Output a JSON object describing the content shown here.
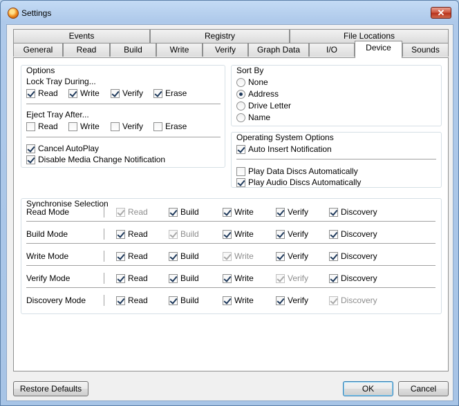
{
  "window": {
    "title": "Settings",
    "close_glyph": "✕"
  },
  "tabs": {
    "row_back": [
      "Events",
      "Registry",
      "File Locations"
    ],
    "row_front": [
      "General",
      "Read",
      "Build",
      "Write",
      "Verify",
      "Graph Data",
      "I/O",
      "Device",
      "Sounds"
    ],
    "active": "Device"
  },
  "options": {
    "title": "Options",
    "lock_label": "Lock Tray During...",
    "lock": [
      {
        "label": "Read",
        "checked": true
      },
      {
        "label": "Write",
        "checked": true
      },
      {
        "label": "Verify",
        "checked": true
      },
      {
        "label": "Erase",
        "checked": true
      }
    ],
    "eject_label": "Eject Tray After...",
    "eject": [
      {
        "label": "Read",
        "checked": false
      },
      {
        "label": "Write",
        "checked": false
      },
      {
        "label": "Verify",
        "checked": false
      },
      {
        "label": "Erase",
        "checked": false
      }
    ],
    "cancel_autoplay": {
      "label": "Cancel AutoPlay",
      "checked": true
    },
    "disable_media": {
      "label": "Disable Media Change Notification",
      "checked": true
    }
  },
  "sort_by": {
    "title": "Sort By",
    "options": [
      "None",
      "Address",
      "Drive Letter",
      "Name"
    ],
    "selected": "Address"
  },
  "os_options": {
    "title": "Operating System Options",
    "auto_insert": {
      "label": "Auto Insert Notification",
      "checked": true
    },
    "play_data": {
      "label": "Play Data Discs Automatically",
      "checked": false
    },
    "play_audio": {
      "label": "Play Audio Discs Automatically",
      "checked": true
    }
  },
  "sync": {
    "title": "Synchronise Selection",
    "columns": [
      "Read",
      "Build",
      "Write",
      "Verify",
      "Discovery"
    ],
    "rows": [
      {
        "label": "Read Mode",
        "disabled_col": 0
      },
      {
        "label": "Build Mode",
        "disabled_col": 1
      },
      {
        "label": "Write Mode",
        "disabled_col": 2
      },
      {
        "label": "Verify Mode",
        "disabled_col": 3
      },
      {
        "label": "Discovery Mode",
        "disabled_col": 4
      }
    ]
  },
  "buttons": {
    "restore": "Restore Defaults",
    "ok": "OK",
    "cancel": "Cancel"
  },
  "colors": {
    "title_bg": "#b8d0ec",
    "close": "#c7432b",
    "check": "#1e395b"
  }
}
